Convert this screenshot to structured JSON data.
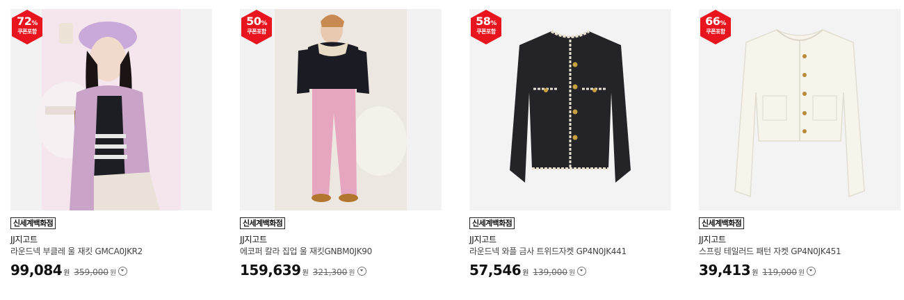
{
  "products": [
    {
      "discount": "72",
      "percent_sign": "%",
      "coupon_label": "쿠폰포함",
      "store": "신세계백화점",
      "brand": "JJ지고트",
      "name": "라운드넥 부클레 울 재킷 GMCA0JKR2",
      "price": "99,084",
      "price_unit": "원",
      "original_price": "359,000",
      "original_unit": "원"
    },
    {
      "discount": "50",
      "percent_sign": "%",
      "coupon_label": "쿠폰포함",
      "store": "신세계백화점",
      "brand": "JJ지고트",
      "name": "에코퍼 칼라 집업 울 재킷GNBM0JK90",
      "price": "159,639",
      "price_unit": "원",
      "original_price": "321,300",
      "original_unit": "원"
    },
    {
      "discount": "58",
      "percent_sign": "%",
      "coupon_label": "쿠폰포함",
      "store": "신세계백화점",
      "brand": "JJ지고트",
      "name": "라운드넥 와플 금사 트위드자켓 GP4N0JK441",
      "price": "57,546",
      "price_unit": "원",
      "original_price": "139,000",
      "original_unit": "원"
    },
    {
      "discount": "66",
      "percent_sign": "%",
      "coupon_label": "쿠폰포함",
      "store": "신세계백화점",
      "brand": "JJ지고트",
      "name": "스프링 테일러드 패턴 자켓 GP4N0JK451",
      "price": "39,413",
      "price_unit": "원",
      "original_price": "119,000",
      "original_unit": "원"
    }
  ],
  "colors": {
    "badge_red": "#e8141e",
    "thumb_bg": "#f3f3f3"
  }
}
